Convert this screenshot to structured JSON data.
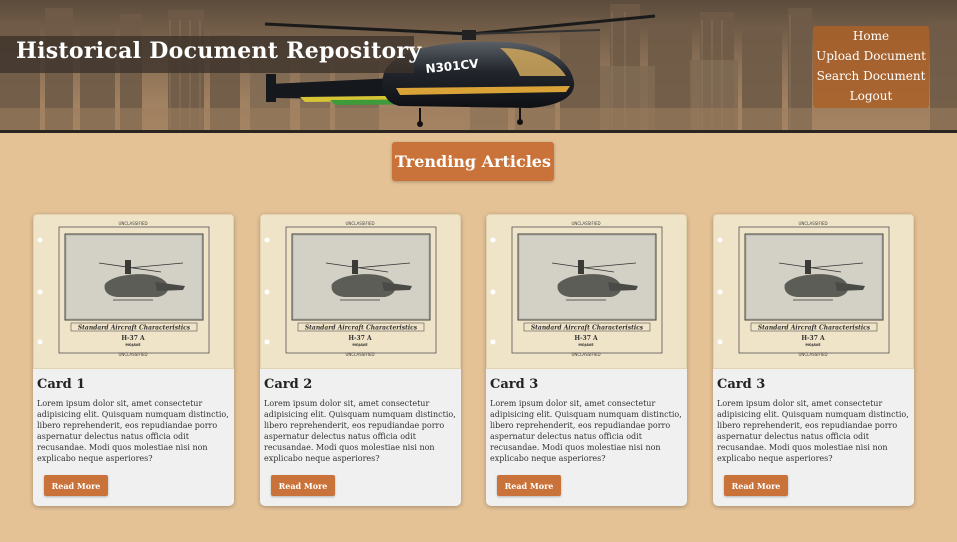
{
  "header": {
    "title": "Historical Document Repository",
    "helicopter_tail_number": "N301CV",
    "nav": [
      {
        "label": "Home"
      },
      {
        "label": "Upload Document"
      },
      {
        "label": "Search Document"
      },
      {
        "label": "Logout"
      }
    ]
  },
  "trending": {
    "label": "Trending Articles"
  },
  "cards": [
    {
      "title": "Card 1",
      "body": "Lorem ipsum dolor sit, amet consectetur adipisicing elit. Quisquam numquam distinctio, libero reprehenderit, eos repudiandae porro aspernatur delectus natus officia odit recusandae. Modi quos molestiae nisi non explicabo neque asperiores?",
      "button": "Read More",
      "doc": {
        "header": "UNCLASSIFIED",
        "caption": "Standard Aircraft Characteristics",
        "model": "H-37 A",
        "name": "MOJAVE",
        "footer": "UNCLASSIFIED"
      }
    },
    {
      "title": "Card 2",
      "body": "Lorem ipsum dolor sit, amet consectetur adipisicing elit. Quisquam numquam distinctio, libero reprehenderit, eos repudiandae porro aspernatur delectus natus officia odit recusandae. Modi quos molestiae nisi non explicabo neque asperiores?",
      "button": "Read More",
      "doc": {
        "header": "UNCLASSIFIED",
        "caption": "Standard Aircraft Characteristics",
        "model": "H-37 A",
        "name": "MOJAVE",
        "footer": "UNCLASSIFIED"
      }
    },
    {
      "title": "Card 3",
      "body": "Lorem ipsum dolor sit, amet consectetur adipisicing elit. Quisquam numquam distinctio, libero reprehenderit, eos repudiandae porro aspernatur delectus natus officia odit recusandae. Modi quos molestiae nisi non explicabo neque asperiores?",
      "button": "Read More",
      "doc": {
        "header": "UNCLASSIFIED",
        "caption": "Standard Aircraft Characteristics",
        "model": "H-37 A",
        "name": "MOJAVE",
        "footer": "UNCLASSIFIED"
      }
    },
    {
      "title": "Card 3",
      "body": "Lorem ipsum dolor sit, amet consectetur adipisicing elit. Quisquam numquam distinctio, libero reprehenderit, eos repudiandae porro aspernatur delectus natus officia odit recusandae. Modi quos molestiae nisi non explicabo neque asperiores?",
      "button": "Read More",
      "doc": {
        "header": "UNCLASSIFIED",
        "caption": "Standard Aircraft Characteristics",
        "model": "H-37 A",
        "name": "MOJAVE",
        "footer": "UNCLASSIFIED"
      }
    }
  ],
  "colors": {
    "page_bg": "#e4c296",
    "accent": "#c9733a",
    "nav_bg": "#aa6028",
    "card_bg": "#f1f0f0"
  }
}
